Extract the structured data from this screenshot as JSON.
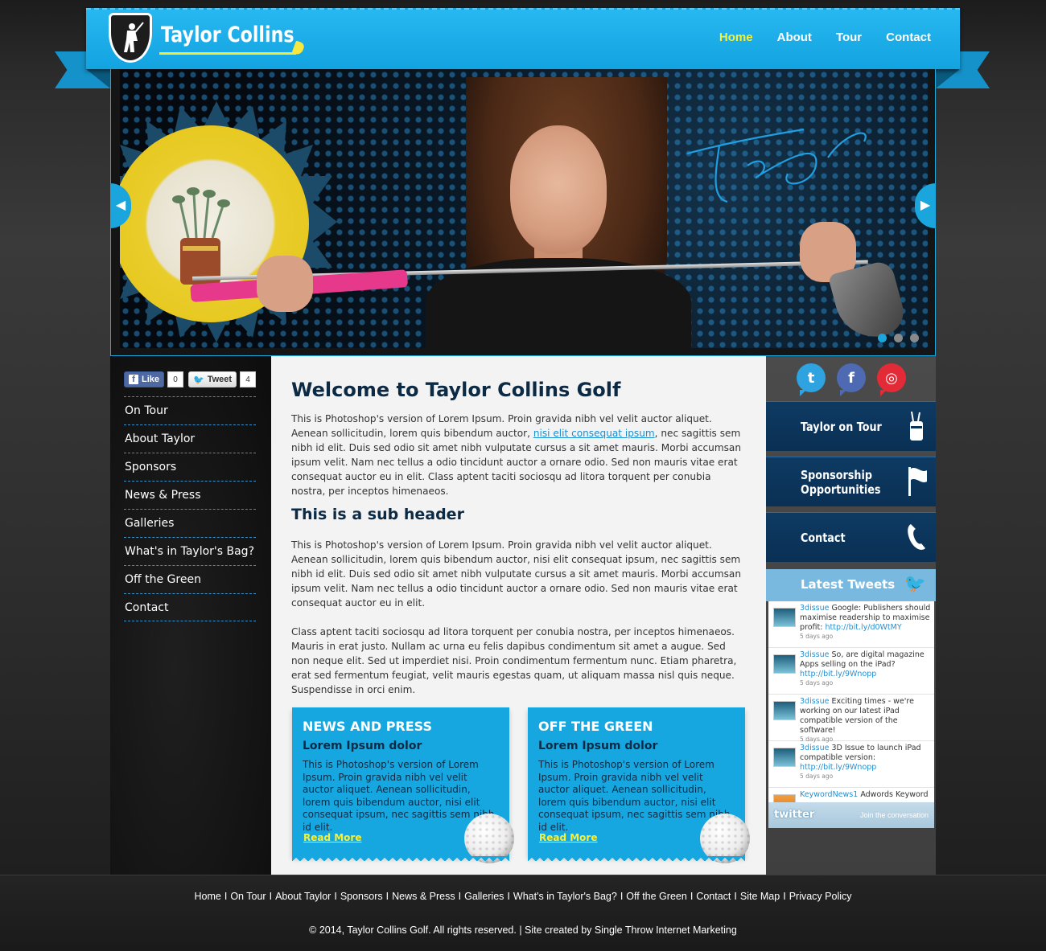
{
  "header": {
    "logo_text": "Taylor Collins",
    "nav": [
      {
        "label": "Home",
        "active": true
      },
      {
        "label": "About",
        "active": false
      },
      {
        "label": "Tour",
        "active": false
      },
      {
        "label": "Contact",
        "active": false
      }
    ]
  },
  "slider": {
    "prev_icon": "◀",
    "next_icon": "▶",
    "slide_count": 3,
    "active_slide": 1,
    "accent_color": "#1aa6dd"
  },
  "social_share": {
    "like_label": "Like",
    "like_count": "0",
    "tweet_label": "Tweet",
    "tweet_count": "4"
  },
  "left_menu": [
    "On Tour",
    "About Taylor",
    "Sponsors",
    "News & Press",
    "Galleries",
    "What's in Taylor's Bag?",
    "Off the Green",
    "Contact"
  ],
  "main": {
    "title": "Welcome to Taylor Collins Golf",
    "intro_before_link": "This is Photoshop's version  of Lorem Ipsum. Proin gravida nibh vel velit auctor aliquet. Aenean sollicitudin, lorem quis bibendum auctor, ",
    "intro_link": "nisi elit consequat ipsum",
    "intro_after_link": ", nec sagittis sem nibh id elit. Duis sed odio sit amet nibh vulputate cursus a sit amet mauris. Morbi accumsan ipsum velit. Nam nec tellus a odio tincidunt auctor a ornare odio. Sed non  mauris vitae erat consequat auctor eu in elit. Class aptent taciti sociosqu ad litora torquent per conubia nostra, per inceptos himenaeos.",
    "subheader": "This is a sub header",
    "para2": "This is Photoshop's version  of Lorem Ipsum. Proin gravida nibh vel velit auctor aliquet. Aenean sollicitudin, lorem quis bibendum auctor, nisi elit consequat ipsum, nec sagittis sem nibh id elit. Duis sed odio sit amet nibh vulputate cursus a sit amet mauris. Morbi accumsan ipsum velit. Nam nec tellus a odio tincidunt auctor a ornare odio. Sed non  mauris vitae erat consequat auctor eu in elit.",
    "para3": "Class aptent taciti sociosqu ad litora torquent per conubia nostra, per inceptos himenaeos. Mauris in erat justo. Nullam ac urna eu felis dapibus condimentum sit amet a augue. Sed non neque elit. Sed ut imperdiet nisi. Proin condimentum fermentum nunc. Etiam pharetra, erat sed fermentum feugiat, velit mauris egestas quam, ut aliquam massa nisl quis neque. Suspendisse in orci enim.",
    "boxes": [
      {
        "title": "NEWS AND PRESS",
        "subtitle": "Lorem Ipsum dolor",
        "text": "This is Photoshop's version  of Lorem Ipsum. Proin gravida nibh vel velit auctor aliquet. Aenean sollicitudin, lorem quis bibendum auctor, nisi elit consequat ipsum, nec sagittis sem nibh id elit.",
        "link": "Read More"
      },
      {
        "title": "OFF THE GREEN",
        "subtitle": "Lorem Ipsum dolor",
        "text": "This is Photoshop's version  of Lorem Ipsum. Proin gravida nibh vel velit auctor aliquet. Aenean sollicitudin, lorem quis bibendum auctor, nisi elit consequat ipsum, nec sagittis sem nibh id elit.",
        "link": "Read More"
      }
    ]
  },
  "right_sidebar": {
    "social_icons": [
      "twitter-icon",
      "facebook-icon",
      "instagram-icon"
    ],
    "buttons": [
      {
        "label": "Taylor on Tour",
        "icon": "golf-bag-icon"
      },
      {
        "label": "Sponsorship\nOpportunities",
        "icon": "flag-icon"
      },
      {
        "label": "Contact",
        "icon": "phone-icon"
      }
    ],
    "tweets_title": "Latest Tweets",
    "tweets": [
      {
        "user": "3dissue",
        "text": " Google: Publishers should maximise readership to maximise profit: ",
        "link": "http://bit.ly/d0WtMY",
        "time": "5 days ago"
      },
      {
        "user": "3dissue",
        "text": " So, are digital magazine Apps selling on the iPad? ",
        "link": "http://bit.ly/9Wnopp",
        "time": "5 days ago"
      },
      {
        "user": "3dissue",
        "text": " Exciting times - we're working on our latest iPad compatible version of the software!",
        "link": "",
        "time": "5 days ago"
      },
      {
        "user": "3dissue",
        "text": " 3D Issue to launch iPad compatible version: ",
        "link": "http://bit.ly/9Wnopp",
        "time": "5 days ago"
      },
      {
        "user": "KeywordNews1",
        "text": " Adwords Keyword",
        "link": "",
        "time": ""
      }
    ],
    "twitter_logo": "twitter",
    "join_text": "Join the conversation"
  },
  "footer": {
    "links": [
      "Home",
      "On Tour",
      "About Taylor",
      "Sponsors",
      "News & Press",
      "Galleries",
      "What's in Taylor's Bag?",
      "Off the Green",
      "Contact",
      "Site Map",
      "Privacy Policy"
    ],
    "separator": "I",
    "copyright": "© 2014, Taylor Collins Golf. All rights reserved. | Site created by Single Throw Internet Marketing"
  },
  "colors": {
    "header_blue": "#12a3e1",
    "nav_active": "#f5f03a",
    "heading_navy": "#0c2a44",
    "side_button_navy": "#0a3054"
  }
}
